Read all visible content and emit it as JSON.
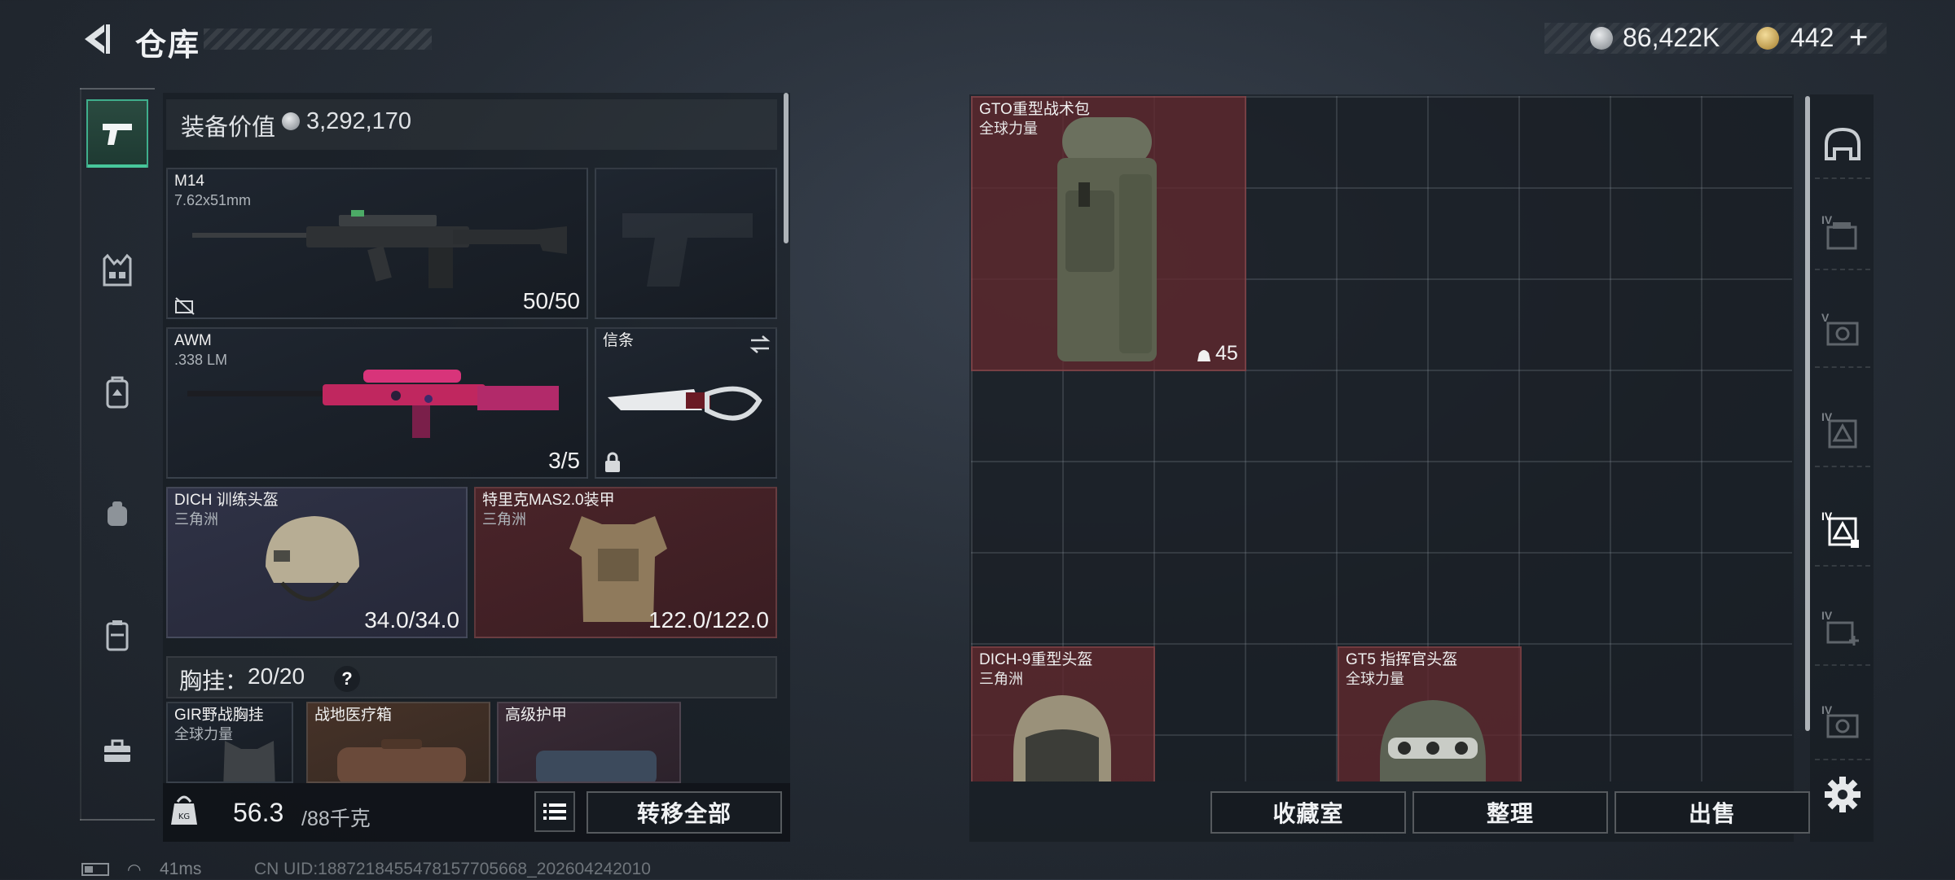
{
  "header": {
    "title": "仓库",
    "currency_primary": "86,422K",
    "currency_secondary": "442",
    "plus_symbol": "+"
  },
  "loadout": {
    "equip_value_label": "装备价值",
    "equip_value": "3,292,170",
    "slots": [
      {
        "name": "M14",
        "sub": "7.62x51mm",
        "count": "50/50"
      },
      {
        "name": "",
        "sub": "",
        "count": ""
      },
      {
        "name": "AWM",
        "sub": ".338 LM",
        "count": "3/5"
      },
      {
        "name": "信条",
        "sub": "",
        "count": ""
      },
      {
        "name": "DICH 训练头盔",
        "sub": "三角洲",
        "count": "34.0/34.0"
      },
      {
        "name": "特里克MAS2.0装甲",
        "sub": "三角洲",
        "count": "122.0/122.0"
      }
    ],
    "chest_label": "胸挂：",
    "chest_value": "20/20",
    "help_symbol": "?",
    "chest_items": [
      {
        "name": "GIR野战胸挂",
        "sub": "全球力量"
      },
      {
        "name": "战地医疗箱",
        "sub": ""
      },
      {
        "name": "高级护甲",
        "sub": ""
      }
    ],
    "weight_value": "56.3",
    "weight_max": "/88千克",
    "transfer_all_label": "转移全部"
  },
  "storage": {
    "items": [
      {
        "name": "GTO重型战术包",
        "sub": "全球力量",
        "count": "45"
      },
      {
        "name": "DICH-9重型头盔",
        "sub": "三角洲",
        "count": ""
      },
      {
        "name": "GT5 指挥官头盔",
        "sub": "全球力量",
        "count": ""
      }
    ],
    "buttons": {
      "collection": "收藏室",
      "sort": "整理",
      "sell": "出售"
    }
  },
  "filters": [
    {
      "icon": "helmet-filter-icon",
      "label": ""
    },
    {
      "icon": "case-filter-icon",
      "label": "IV"
    },
    {
      "icon": "box-filter-icon",
      "label": "V"
    },
    {
      "icon": "triangle-box-filter-icon",
      "label": "IV"
    },
    {
      "icon": "triangle-box-selected-icon",
      "label": "IV"
    },
    {
      "icon": "medic-filter-icon",
      "label": "IV"
    },
    {
      "icon": "box-filter-icon-2",
      "label": "IV"
    }
  ],
  "status": {
    "ping": "41ms",
    "uid": "CN UID:1887218455478157705668_202604242010"
  },
  "colors": {
    "accent_green": "#48c79b",
    "item_red": "#62292e",
    "panel_dark": "#161b21"
  }
}
